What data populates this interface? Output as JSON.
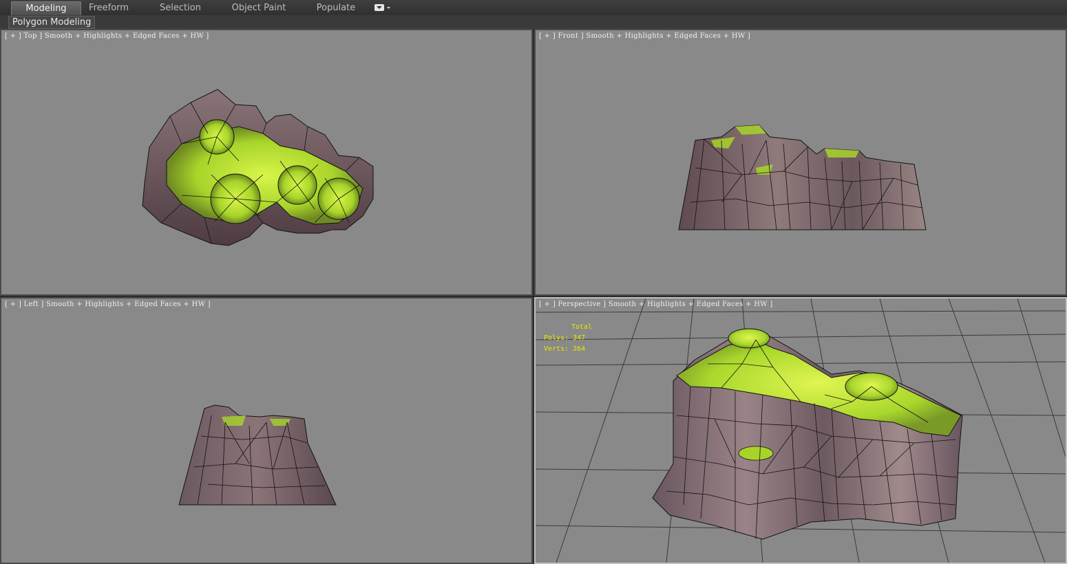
{
  "ribbon": {
    "tabs": [
      "Modeling",
      "Freeform",
      "Selection",
      "Object Paint",
      "Populate"
    ],
    "active_tab": "Modeling",
    "panel_label": "Polygon Modeling"
  },
  "viewports": {
    "top": {
      "label": "[ + ] Top ] Smooth + Highlights + Edged Faces + HW ]"
    },
    "front": {
      "label": "[ + ] Front ] Smooth + Highlights + Edged Faces + HW ]"
    },
    "left": {
      "label": "[ + ] Left ] Smooth + Highlights + Edged Faces + HW ]"
    },
    "perspective": {
      "label": "[ + ] Perspective ] Smooth + Highlights + Edged Faces + HW ]",
      "stats": {
        "title": "Total",
        "polys": "Polys: 347",
        "verts": "Verts: 264"
      }
    }
  },
  "colors": {
    "viewport_bg": "#898989",
    "rock": "#7a6468",
    "rock_dark": "#4e3e42",
    "moss": "#a8d82a",
    "moss_bright": "#d4f24a",
    "edge": "#111111",
    "stats_text": "#e8e800"
  }
}
